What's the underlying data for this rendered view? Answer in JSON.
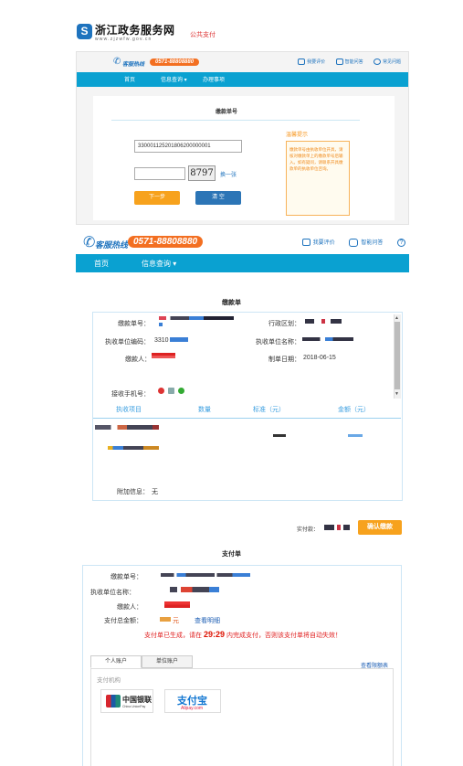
{
  "header": {
    "logo_char": "S",
    "site_title": "浙江政务服务网",
    "site_domain": "www.zjzwfw.gov.cn",
    "section_tag": "公共支付"
  },
  "panel_small": {
    "hotline_label": "客服热线",
    "hotline_number": "0571-88808880",
    "top_links": [
      "我要评价",
      "智能问答",
      "常见问题"
    ],
    "nav": [
      "首页",
      "信息查询 ▾",
      "办理事项"
    ],
    "form_title": "缴款单号",
    "bill_number_value": "330001125201806200000001",
    "captcha_text": "8797",
    "change_captcha": "换一张",
    "next_button": "下一步",
    "clear_button": "清 空",
    "tips_title": "温馨提示",
    "tips_text": "缴款单号由执收单位开具，请核对缴款单上的缴款单号后输入。如有疑问，请联系开具缴款单的执收单位咨询。"
  },
  "panel_main": {
    "hotline_label": "客服热线",
    "hotline_number": "0571-88808880",
    "top_links": [
      "我要评价",
      "智能问答"
    ],
    "nav": [
      "首页",
      "信息查询 ▾"
    ]
  },
  "notice": {
    "title": "缴款单",
    "fields": {
      "bill_no_label": "缴款单号：",
      "region_label": "行政区划：",
      "collector_code_label": "执收单位编码：",
      "collector_code_value": "3310",
      "collector_name_label": "执收单位名称：",
      "payer_label": "缴款人：",
      "date_label": "制单日期：",
      "date_value": "2018-06-15",
      "phone_label": "接收手机号："
    },
    "table_headers": [
      "执收项目",
      "数量",
      "标准（元）",
      "金额（元）"
    ],
    "extra_label": "附加信息：",
    "extra_value": "无",
    "pay_amount_label": "实付款：",
    "confirm_button": "确认缴款"
  },
  "slip": {
    "title": "支付单",
    "bill_no_label": "缴款单号：",
    "collector_name_label": "执收单位名称：",
    "payer_label": "缴款人：",
    "total_label": "支付总金额：",
    "total_unit": "元",
    "detail_link": "查看明细",
    "countdown_prefix": "支付单已生成，请在",
    "countdown_time": "29:29",
    "countdown_suffix": "内完成支付，否则该支付单将自动失效！",
    "tabs": [
      "个人账户",
      "单位账户"
    ],
    "limits_link": "查看限额表",
    "institutions_label": "支付机构",
    "banks": [
      {
        "name_cn": "中国银联",
        "name_en": "China UnionPay"
      },
      {
        "name_cn": "支付宝",
        "name_en": "Alipay.com"
      }
    ]
  },
  "colors": {
    "nav_blue": "#0aa1d1",
    "brand_blue": "#1e73be",
    "orange": "#f7a21d",
    "alert_red": "#e02020"
  }
}
